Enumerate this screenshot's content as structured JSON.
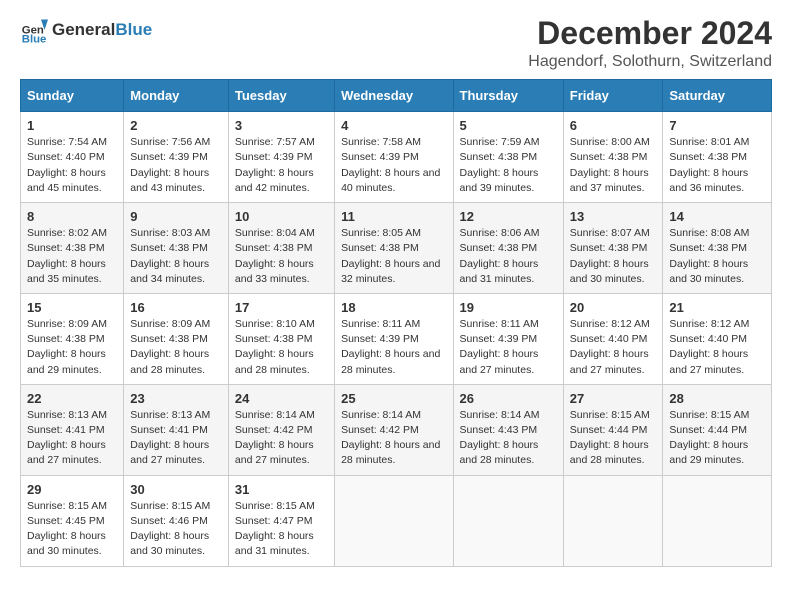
{
  "header": {
    "logo_general": "General",
    "logo_blue": "Blue",
    "title": "December 2024",
    "subtitle": "Hagendorf, Solothurn, Switzerland"
  },
  "days_of_week": [
    "Sunday",
    "Monday",
    "Tuesday",
    "Wednesday",
    "Thursday",
    "Friday",
    "Saturday"
  ],
  "weeks": [
    [
      {
        "day": "1",
        "sunrise": "Sunrise: 7:54 AM",
        "sunset": "Sunset: 4:40 PM",
        "daylight": "Daylight: 8 hours and 45 minutes."
      },
      {
        "day": "2",
        "sunrise": "Sunrise: 7:56 AM",
        "sunset": "Sunset: 4:39 PM",
        "daylight": "Daylight: 8 hours and 43 minutes."
      },
      {
        "day": "3",
        "sunrise": "Sunrise: 7:57 AM",
        "sunset": "Sunset: 4:39 PM",
        "daylight": "Daylight: 8 hours and 42 minutes."
      },
      {
        "day": "4",
        "sunrise": "Sunrise: 7:58 AM",
        "sunset": "Sunset: 4:39 PM",
        "daylight": "Daylight: 8 hours and 40 minutes."
      },
      {
        "day": "5",
        "sunrise": "Sunrise: 7:59 AM",
        "sunset": "Sunset: 4:38 PM",
        "daylight": "Daylight: 8 hours and 39 minutes."
      },
      {
        "day": "6",
        "sunrise": "Sunrise: 8:00 AM",
        "sunset": "Sunset: 4:38 PM",
        "daylight": "Daylight: 8 hours and 37 minutes."
      },
      {
        "day": "7",
        "sunrise": "Sunrise: 8:01 AM",
        "sunset": "Sunset: 4:38 PM",
        "daylight": "Daylight: 8 hours and 36 minutes."
      }
    ],
    [
      {
        "day": "8",
        "sunrise": "Sunrise: 8:02 AM",
        "sunset": "Sunset: 4:38 PM",
        "daylight": "Daylight: 8 hours and 35 minutes."
      },
      {
        "day": "9",
        "sunrise": "Sunrise: 8:03 AM",
        "sunset": "Sunset: 4:38 PM",
        "daylight": "Daylight: 8 hours and 34 minutes."
      },
      {
        "day": "10",
        "sunrise": "Sunrise: 8:04 AM",
        "sunset": "Sunset: 4:38 PM",
        "daylight": "Daylight: 8 hours and 33 minutes."
      },
      {
        "day": "11",
        "sunrise": "Sunrise: 8:05 AM",
        "sunset": "Sunset: 4:38 PM",
        "daylight": "Daylight: 8 hours and 32 minutes."
      },
      {
        "day": "12",
        "sunrise": "Sunrise: 8:06 AM",
        "sunset": "Sunset: 4:38 PM",
        "daylight": "Daylight: 8 hours and 31 minutes."
      },
      {
        "day": "13",
        "sunrise": "Sunrise: 8:07 AM",
        "sunset": "Sunset: 4:38 PM",
        "daylight": "Daylight: 8 hours and 30 minutes."
      },
      {
        "day": "14",
        "sunrise": "Sunrise: 8:08 AM",
        "sunset": "Sunset: 4:38 PM",
        "daylight": "Daylight: 8 hours and 30 minutes."
      }
    ],
    [
      {
        "day": "15",
        "sunrise": "Sunrise: 8:09 AM",
        "sunset": "Sunset: 4:38 PM",
        "daylight": "Daylight: 8 hours and 29 minutes."
      },
      {
        "day": "16",
        "sunrise": "Sunrise: 8:09 AM",
        "sunset": "Sunset: 4:38 PM",
        "daylight": "Daylight: 8 hours and 28 minutes."
      },
      {
        "day": "17",
        "sunrise": "Sunrise: 8:10 AM",
        "sunset": "Sunset: 4:38 PM",
        "daylight": "Daylight: 8 hours and 28 minutes."
      },
      {
        "day": "18",
        "sunrise": "Sunrise: 8:11 AM",
        "sunset": "Sunset: 4:39 PM",
        "daylight": "Daylight: 8 hours and 28 minutes."
      },
      {
        "day": "19",
        "sunrise": "Sunrise: 8:11 AM",
        "sunset": "Sunset: 4:39 PM",
        "daylight": "Daylight: 8 hours and 27 minutes."
      },
      {
        "day": "20",
        "sunrise": "Sunrise: 8:12 AM",
        "sunset": "Sunset: 4:40 PM",
        "daylight": "Daylight: 8 hours and 27 minutes."
      },
      {
        "day": "21",
        "sunrise": "Sunrise: 8:12 AM",
        "sunset": "Sunset: 4:40 PM",
        "daylight": "Daylight: 8 hours and 27 minutes."
      }
    ],
    [
      {
        "day": "22",
        "sunrise": "Sunrise: 8:13 AM",
        "sunset": "Sunset: 4:41 PM",
        "daylight": "Daylight: 8 hours and 27 minutes."
      },
      {
        "day": "23",
        "sunrise": "Sunrise: 8:13 AM",
        "sunset": "Sunset: 4:41 PM",
        "daylight": "Daylight: 8 hours and 27 minutes."
      },
      {
        "day": "24",
        "sunrise": "Sunrise: 8:14 AM",
        "sunset": "Sunset: 4:42 PM",
        "daylight": "Daylight: 8 hours and 27 minutes."
      },
      {
        "day": "25",
        "sunrise": "Sunrise: 8:14 AM",
        "sunset": "Sunset: 4:42 PM",
        "daylight": "Daylight: 8 hours and 28 minutes."
      },
      {
        "day": "26",
        "sunrise": "Sunrise: 8:14 AM",
        "sunset": "Sunset: 4:43 PM",
        "daylight": "Daylight: 8 hours and 28 minutes."
      },
      {
        "day": "27",
        "sunrise": "Sunrise: 8:15 AM",
        "sunset": "Sunset: 4:44 PM",
        "daylight": "Daylight: 8 hours and 28 minutes."
      },
      {
        "day": "28",
        "sunrise": "Sunrise: 8:15 AM",
        "sunset": "Sunset: 4:44 PM",
        "daylight": "Daylight: 8 hours and 29 minutes."
      }
    ],
    [
      {
        "day": "29",
        "sunrise": "Sunrise: 8:15 AM",
        "sunset": "Sunset: 4:45 PM",
        "daylight": "Daylight: 8 hours and 30 minutes."
      },
      {
        "day": "30",
        "sunrise": "Sunrise: 8:15 AM",
        "sunset": "Sunset: 4:46 PM",
        "daylight": "Daylight: 8 hours and 30 minutes."
      },
      {
        "day": "31",
        "sunrise": "Sunrise: 8:15 AM",
        "sunset": "Sunset: 4:47 PM",
        "daylight": "Daylight: 8 hours and 31 minutes."
      },
      null,
      null,
      null,
      null
    ]
  ]
}
